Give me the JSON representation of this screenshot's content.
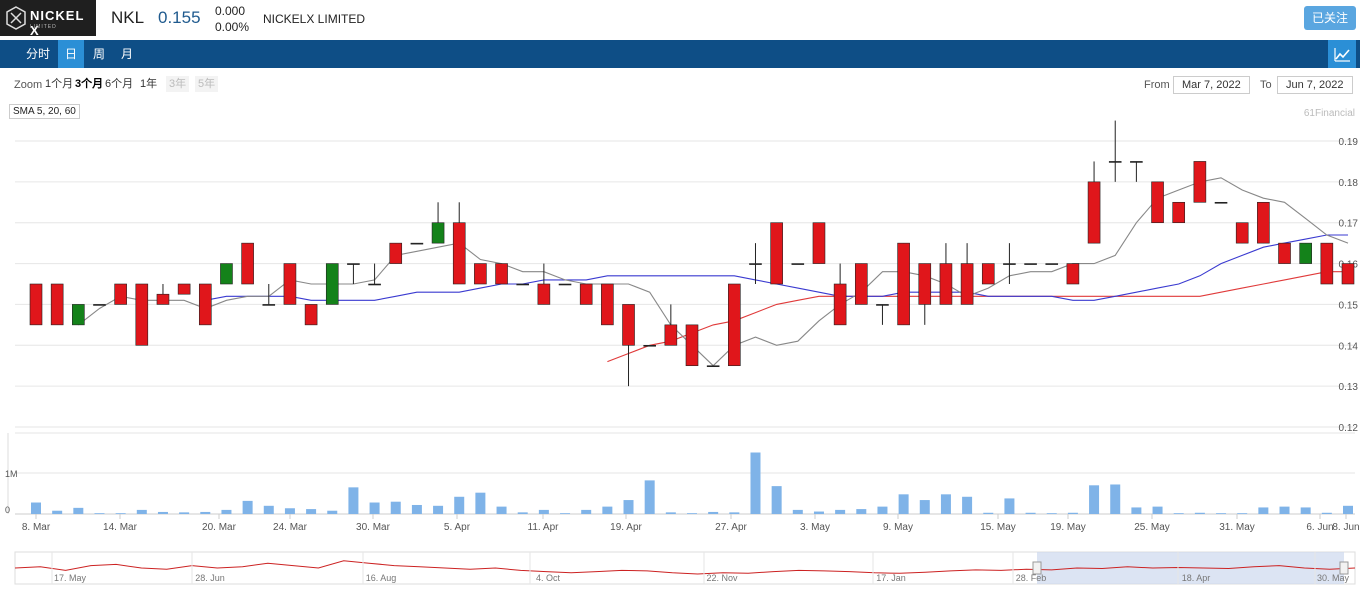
{
  "header": {
    "logo_text": "NICKEL X",
    "logo_sub": "LIMITED",
    "ticker": "NKL",
    "price": "0.155",
    "change": "0.000",
    "change_pct": "0.00%",
    "company": "NICKELX LIMITED",
    "follow_label": "已关注"
  },
  "tabs": [
    {
      "label": "分时",
      "active": false
    },
    {
      "label": "日",
      "active": true
    },
    {
      "label": "周",
      "active": false
    },
    {
      "label": "月",
      "active": false
    }
  ],
  "chart_icon": "line-chart-icon",
  "toolbar": {
    "zoom_label": "Zoom",
    "zoom_buttons": [
      {
        "label": "1个月",
        "state": "normal"
      },
      {
        "label": "3个月",
        "state": "selected"
      },
      {
        "label": "6个月",
        "state": "normal"
      },
      {
        "label": "1年",
        "state": "normal"
      },
      {
        "label": "3年",
        "state": "disabled"
      },
      {
        "label": "5年",
        "state": "disabled"
      }
    ],
    "from_label": "From",
    "from_value": "Mar 7, 2022",
    "to_label": "To",
    "to_value": "Jun 7, 2022"
  },
  "indicator_label": "SMA 5, 20, 60",
  "credit": "61Financial",
  "colors": {
    "up": "#e0161b",
    "down": "#14821a",
    "volume": "#7fb3e8",
    "sma5": "#888888",
    "sma20": "#3a3ad0",
    "sma60": "#e03a3a",
    "navigator": "#cc2222"
  },
  "chart_data": {
    "type": "candlestick",
    "price_ticks": [
      "0.19",
      "0.18",
      "0.17",
      "0.16",
      "0.15",
      "0.14",
      "0.13",
      "0.12"
    ],
    "price_range": [
      0.12,
      0.195
    ],
    "volume_ticks": [
      "1M",
      "0"
    ],
    "date_labels": [
      "8. Mar",
      "14. Mar",
      "20. Mar",
      "24. Mar",
      "30. Mar",
      "5. Apr",
      "11. Apr",
      "19. Apr",
      "27. Apr",
      "3. May",
      "9. May",
      "15. May",
      "19. May",
      "25. May",
      "31. May",
      "6. Jun",
      "8. Jun"
    ],
    "candles": [
      {
        "o": 0.145,
        "h": 0.155,
        "l": 0.145,
        "c": 0.155
      },
      {
        "o": 0.145,
        "h": 0.155,
        "l": 0.145,
        "c": 0.155
      },
      {
        "o": 0.15,
        "h": 0.15,
        "l": 0.145,
        "c": 0.145
      },
      {
        "o": 0.15,
        "h": 0.15,
        "l": 0.15,
        "c": 0.15
      },
      {
        "o": 0.15,
        "h": 0.155,
        "l": 0.15,
        "c": 0.155
      },
      {
        "o": 0.14,
        "h": 0.155,
        "l": 0.14,
        "c": 0.155
      },
      {
        "o": 0.15,
        "h": 0.155,
        "l": 0.15,
        "c": 0.1525
      },
      {
        "o": 0.1525,
        "h": 0.155,
        "l": 0.1525,
        "c": 0.155
      },
      {
        "o": 0.145,
        "h": 0.155,
        "l": 0.145,
        "c": 0.155
      },
      {
        "o": 0.16,
        "h": 0.16,
        "l": 0.155,
        "c": 0.155
      },
      {
        "o": 0.155,
        "h": 0.165,
        "l": 0.155,
        "c": 0.165
      },
      {
        "o": 0.15,
        "h": 0.155,
        "l": 0.15,
        "c": 0.15
      },
      {
        "o": 0.15,
        "h": 0.16,
        "l": 0.15,
        "c": 0.16
      },
      {
        "o": 0.145,
        "h": 0.15,
        "l": 0.145,
        "c": 0.15
      },
      {
        "o": 0.16,
        "h": 0.16,
        "l": 0.15,
        "c": 0.15
      },
      {
        "o": 0.16,
        "h": 0.16,
        "l": 0.155,
        "c": 0.16
      },
      {
        "o": 0.155,
        "h": 0.16,
        "l": 0.155,
        "c": 0.155
      },
      {
        "o": 0.16,
        "h": 0.165,
        "l": 0.16,
        "c": 0.165
      },
      {
        "o": 0.165,
        "h": 0.165,
        "l": 0.165,
        "c": 0.165
      },
      {
        "o": 0.17,
        "h": 0.175,
        "l": 0.165,
        "c": 0.165
      },
      {
        "o": 0.155,
        "h": 0.175,
        "l": 0.155,
        "c": 0.17
      },
      {
        "o": 0.155,
        "h": 0.16,
        "l": 0.155,
        "c": 0.16
      },
      {
        "o": 0.155,
        "h": 0.16,
        "l": 0.155,
        "c": 0.16
      },
      {
        "o": 0.155,
        "h": 0.155,
        "l": 0.155,
        "c": 0.155
      },
      {
        "o": 0.15,
        "h": 0.16,
        "l": 0.15,
        "c": 0.155
      },
      {
        "o": 0.155,
        "h": 0.155,
        "l": 0.155,
        "c": 0.155
      },
      {
        "o": 0.15,
        "h": 0.155,
        "l": 0.15,
        "c": 0.155
      },
      {
        "o": 0.145,
        "h": 0.155,
        "l": 0.145,
        "c": 0.155
      },
      {
        "o": 0.14,
        "h": 0.15,
        "l": 0.13,
        "c": 0.15
      },
      {
        "o": 0.14,
        "h": 0.14,
        "l": 0.14,
        "c": 0.14
      },
      {
        "o": 0.14,
        "h": 0.15,
        "l": 0.14,
        "c": 0.145
      },
      {
        "o": 0.135,
        "h": 0.145,
        "l": 0.135,
        "c": 0.145
      },
      {
        "o": 0.135,
        "h": 0.135,
        "l": 0.135,
        "c": 0.135
      },
      {
        "o": 0.135,
        "h": 0.155,
        "l": 0.135,
        "c": 0.155
      },
      {
        "o": 0.16,
        "h": 0.165,
        "l": 0.155,
        "c": 0.16
      },
      {
        "o": 0.155,
        "h": 0.17,
        "l": 0.155,
        "c": 0.17
      },
      {
        "o": 0.16,
        "h": 0.16,
        "l": 0.16,
        "c": 0.16
      },
      {
        "o": 0.16,
        "h": 0.17,
        "l": 0.16,
        "c": 0.17
      },
      {
        "o": 0.145,
        "h": 0.16,
        "l": 0.145,
        "c": 0.155
      },
      {
        "o": 0.15,
        "h": 0.16,
        "l": 0.15,
        "c": 0.16
      },
      {
        "o": 0.15,
        "h": 0.15,
        "l": 0.145,
        "c": 0.15
      },
      {
        "o": 0.145,
        "h": 0.165,
        "l": 0.145,
        "c": 0.165
      },
      {
        "o": 0.15,
        "h": 0.16,
        "l": 0.145,
        "c": 0.16
      },
      {
        "o": 0.15,
        "h": 0.165,
        "l": 0.15,
        "c": 0.16
      },
      {
        "o": 0.15,
        "h": 0.165,
        "l": 0.15,
        "c": 0.16
      },
      {
        "o": 0.155,
        "h": 0.16,
        "l": 0.155,
        "c": 0.16
      },
      {
        "o": 0.16,
        "h": 0.165,
        "l": 0.155,
        "c": 0.16
      },
      {
        "o": 0.16,
        "h": 0.16,
        "l": 0.16,
        "c": 0.16
      },
      {
        "o": 0.16,
        "h": 0.16,
        "l": 0.16,
        "c": 0.16
      },
      {
        "o": 0.155,
        "h": 0.16,
        "l": 0.155,
        "c": 0.16
      },
      {
        "o": 0.165,
        "h": 0.185,
        "l": 0.165,
        "c": 0.18
      },
      {
        "o": 0.185,
        "h": 0.195,
        "l": 0.18,
        "c": 0.185
      },
      {
        "o": 0.185,
        "h": 0.185,
        "l": 0.18,
        "c": 0.185
      },
      {
        "o": 0.17,
        "h": 0.18,
        "l": 0.17,
        "c": 0.18
      },
      {
        "o": 0.17,
        "h": 0.175,
        "l": 0.17,
        "c": 0.175
      },
      {
        "o": 0.175,
        "h": 0.185,
        "l": 0.175,
        "c": 0.185
      },
      {
        "o": 0.175,
        "h": 0.175,
        "l": 0.175,
        "c": 0.175
      },
      {
        "o": 0.165,
        "h": 0.17,
        "l": 0.165,
        "c": 0.17
      },
      {
        "o": 0.165,
        "h": 0.175,
        "l": 0.165,
        "c": 0.175
      },
      {
        "o": 0.16,
        "h": 0.165,
        "l": 0.16,
        "c": 0.165
      },
      {
        "o": 0.165,
        "h": 0.165,
        "l": 0.16,
        "c": 0.16
      },
      {
        "o": 0.155,
        "h": 0.165,
        "l": 0.155,
        "c": 0.165
      },
      {
        "o": 0.155,
        "h": 0.16,
        "l": 0.155,
        "c": 0.16
      }
    ],
    "volumes": [
      0.28,
      0.08,
      0.15,
      0.02,
      0.02,
      0.1,
      0.05,
      0.04,
      0.05,
      0.1,
      0.32,
      0.2,
      0.14,
      0.12,
      0.08,
      0.65,
      0.28,
      0.3,
      0.22,
      0.2,
      0.42,
      0.52,
      0.18,
      0.04,
      0.1,
      0.02,
      0.1,
      0.18,
      0.34,
      0.82,
      0.04,
      0.02,
      0.05,
      0.04,
      1.5,
      0.68,
      0.1,
      0.06,
      0.1,
      0.12,
      0.18,
      0.48,
      0.34,
      0.48,
      0.42,
      0.03,
      0.38,
      0.03,
      0.02,
      0.03,
      0.7,
      0.72,
      0.16,
      0.18,
      0.02,
      0.03,
      0.02,
      0.02,
      0.16,
      0.18,
      0.16,
      0.03,
      0.2,
      0.1
    ],
    "sma5": [
      0.145,
      0.149,
      0.152,
      0.151,
      0.151,
      0.151,
      0.149,
      0.151,
      0.152,
      0.152,
      0.156,
      0.155,
      0.155,
      0.155,
      0.156,
      0.162,
      0.163,
      0.164,
      0.165,
      0.161,
      0.16,
      0.158,
      0.158,
      0.156,
      0.155,
      0.155,
      0.155,
      0.153,
      0.145,
      0.14,
      0.135,
      0.14,
      0.142,
      0.14,
      0.141,
      0.146,
      0.15,
      0.153,
      0.158,
      0.158,
      0.157,
      0.155,
      0.152,
      0.154,
      0.157,
      0.158,
      0.158,
      0.16,
      0.16,
      0.162,
      0.17,
      0.176,
      0.178,
      0.18,
      0.181,
      0.178,
      0.176,
      0.175,
      0.171,
      0.167,
      0.165
    ],
    "sma20": [
      0.151,
      0.152,
      0.152,
      0.152,
      0.152,
      0.151,
      0.151,
      0.151,
      0.151,
      0.152,
      0.153,
      0.153,
      0.153,
      0.154,
      0.155,
      0.155,
      0.156,
      0.156,
      0.156,
      0.157,
      0.157,
      0.157,
      0.157,
      0.157,
      0.157,
      0.157,
      0.156,
      0.155,
      0.154,
      0.153,
      0.152,
      0.152,
      0.152,
      0.153,
      0.153,
      0.153,
      0.153,
      0.152,
      0.152,
      0.152,
      0.152,
      0.151,
      0.151,
      0.152,
      0.153,
      0.154,
      0.155,
      0.157,
      0.16,
      0.162,
      0.164,
      0.165,
      0.166,
      0.167,
      0.167
    ],
    "sma60": [
      0.136,
      0.138,
      0.14,
      0.141,
      0.143,
      0.145,
      0.146,
      0.148,
      0.15,
      0.151,
      0.152,
      0.152,
      0.152,
      0.152,
      0.152,
      0.152,
      0.152,
      0.152,
      0.152,
      0.152,
      0.152,
      0.152,
      0.152,
      0.152,
      0.152,
      0.152,
      0.152,
      0.152,
      0.152,
      0.153,
      0.154,
      0.155,
      0.156,
      0.157,
      0.158,
      0.158
    ],
    "navigator_labels": [
      "17. May",
      "28. Jun",
      "16. Aug",
      "4. Oct",
      "22. Nov",
      "17. Jan",
      "28. Feb",
      "18. Apr",
      "30. May"
    ],
    "navigator_series": [
      0.5,
      0.55,
      0.4,
      0.6,
      0.65,
      0.5,
      0.45,
      0.6,
      0.5,
      0.55,
      0.7,
      0.6,
      0.5,
      0.8,
      0.7,
      0.6,
      0.55,
      0.5,
      0.45,
      0.5,
      0.4,
      0.35,
      0.3,
      0.35,
      0.4,
      0.38,
      0.3,
      0.25,
      0.3,
      0.28,
      0.35,
      0.4,
      0.38,
      0.35,
      0.3,
      0.28,
      0.32,
      0.38,
      0.42,
      0.4,
      0.45,
      0.42,
      0.5,
      0.48,
      0.55,
      0.5,
      0.52,
      0.5,
      0.48,
      0.55,
      0.6,
      0.5,
      0.45,
      0.5
    ]
  }
}
